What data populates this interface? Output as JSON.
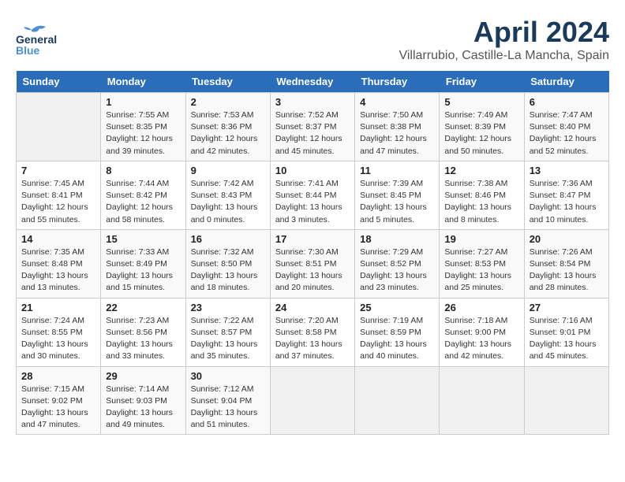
{
  "header": {
    "logo_line1": "General",
    "logo_line2": "Blue",
    "title": "April 2024",
    "subtitle": "Villarrubio, Castille-La Mancha, Spain"
  },
  "weekdays": [
    "Sunday",
    "Monday",
    "Tuesday",
    "Wednesday",
    "Thursday",
    "Friday",
    "Saturday"
  ],
  "weeks": [
    [
      {
        "day": "",
        "info": ""
      },
      {
        "day": "1",
        "info": "Sunrise: 7:55 AM\nSunset: 8:35 PM\nDaylight: 12 hours\nand 39 minutes."
      },
      {
        "day": "2",
        "info": "Sunrise: 7:53 AM\nSunset: 8:36 PM\nDaylight: 12 hours\nand 42 minutes."
      },
      {
        "day": "3",
        "info": "Sunrise: 7:52 AM\nSunset: 8:37 PM\nDaylight: 12 hours\nand 45 minutes."
      },
      {
        "day": "4",
        "info": "Sunrise: 7:50 AM\nSunset: 8:38 PM\nDaylight: 12 hours\nand 47 minutes."
      },
      {
        "day": "5",
        "info": "Sunrise: 7:49 AM\nSunset: 8:39 PM\nDaylight: 12 hours\nand 50 minutes."
      },
      {
        "day": "6",
        "info": "Sunrise: 7:47 AM\nSunset: 8:40 PM\nDaylight: 12 hours\nand 52 minutes."
      }
    ],
    [
      {
        "day": "7",
        "info": "Sunrise: 7:45 AM\nSunset: 8:41 PM\nDaylight: 12 hours\nand 55 minutes."
      },
      {
        "day": "8",
        "info": "Sunrise: 7:44 AM\nSunset: 8:42 PM\nDaylight: 12 hours\nand 58 minutes."
      },
      {
        "day": "9",
        "info": "Sunrise: 7:42 AM\nSunset: 8:43 PM\nDaylight: 13 hours\nand 0 minutes."
      },
      {
        "day": "10",
        "info": "Sunrise: 7:41 AM\nSunset: 8:44 PM\nDaylight: 13 hours\nand 3 minutes."
      },
      {
        "day": "11",
        "info": "Sunrise: 7:39 AM\nSunset: 8:45 PM\nDaylight: 13 hours\nand 5 minutes."
      },
      {
        "day": "12",
        "info": "Sunrise: 7:38 AM\nSunset: 8:46 PM\nDaylight: 13 hours\nand 8 minutes."
      },
      {
        "day": "13",
        "info": "Sunrise: 7:36 AM\nSunset: 8:47 PM\nDaylight: 13 hours\nand 10 minutes."
      }
    ],
    [
      {
        "day": "14",
        "info": "Sunrise: 7:35 AM\nSunset: 8:48 PM\nDaylight: 13 hours\nand 13 minutes."
      },
      {
        "day": "15",
        "info": "Sunrise: 7:33 AM\nSunset: 8:49 PM\nDaylight: 13 hours\nand 15 minutes."
      },
      {
        "day": "16",
        "info": "Sunrise: 7:32 AM\nSunset: 8:50 PM\nDaylight: 13 hours\nand 18 minutes."
      },
      {
        "day": "17",
        "info": "Sunrise: 7:30 AM\nSunset: 8:51 PM\nDaylight: 13 hours\nand 20 minutes."
      },
      {
        "day": "18",
        "info": "Sunrise: 7:29 AM\nSunset: 8:52 PM\nDaylight: 13 hours\nand 23 minutes."
      },
      {
        "day": "19",
        "info": "Sunrise: 7:27 AM\nSunset: 8:53 PM\nDaylight: 13 hours\nand 25 minutes."
      },
      {
        "day": "20",
        "info": "Sunrise: 7:26 AM\nSunset: 8:54 PM\nDaylight: 13 hours\nand 28 minutes."
      }
    ],
    [
      {
        "day": "21",
        "info": "Sunrise: 7:24 AM\nSunset: 8:55 PM\nDaylight: 13 hours\nand 30 minutes."
      },
      {
        "day": "22",
        "info": "Sunrise: 7:23 AM\nSunset: 8:56 PM\nDaylight: 13 hours\nand 33 minutes."
      },
      {
        "day": "23",
        "info": "Sunrise: 7:22 AM\nSunset: 8:57 PM\nDaylight: 13 hours\nand 35 minutes."
      },
      {
        "day": "24",
        "info": "Sunrise: 7:20 AM\nSunset: 8:58 PM\nDaylight: 13 hours\nand 37 minutes."
      },
      {
        "day": "25",
        "info": "Sunrise: 7:19 AM\nSunset: 8:59 PM\nDaylight: 13 hours\nand 40 minutes."
      },
      {
        "day": "26",
        "info": "Sunrise: 7:18 AM\nSunset: 9:00 PM\nDaylight: 13 hours\nand 42 minutes."
      },
      {
        "day": "27",
        "info": "Sunrise: 7:16 AM\nSunset: 9:01 PM\nDaylight: 13 hours\nand 45 minutes."
      }
    ],
    [
      {
        "day": "28",
        "info": "Sunrise: 7:15 AM\nSunset: 9:02 PM\nDaylight: 13 hours\nand 47 minutes."
      },
      {
        "day": "29",
        "info": "Sunrise: 7:14 AM\nSunset: 9:03 PM\nDaylight: 13 hours\nand 49 minutes."
      },
      {
        "day": "30",
        "info": "Sunrise: 7:12 AM\nSunset: 9:04 PM\nDaylight: 13 hours\nand 51 minutes."
      },
      {
        "day": "",
        "info": ""
      },
      {
        "day": "",
        "info": ""
      },
      {
        "day": "",
        "info": ""
      },
      {
        "day": "",
        "info": ""
      }
    ]
  ]
}
